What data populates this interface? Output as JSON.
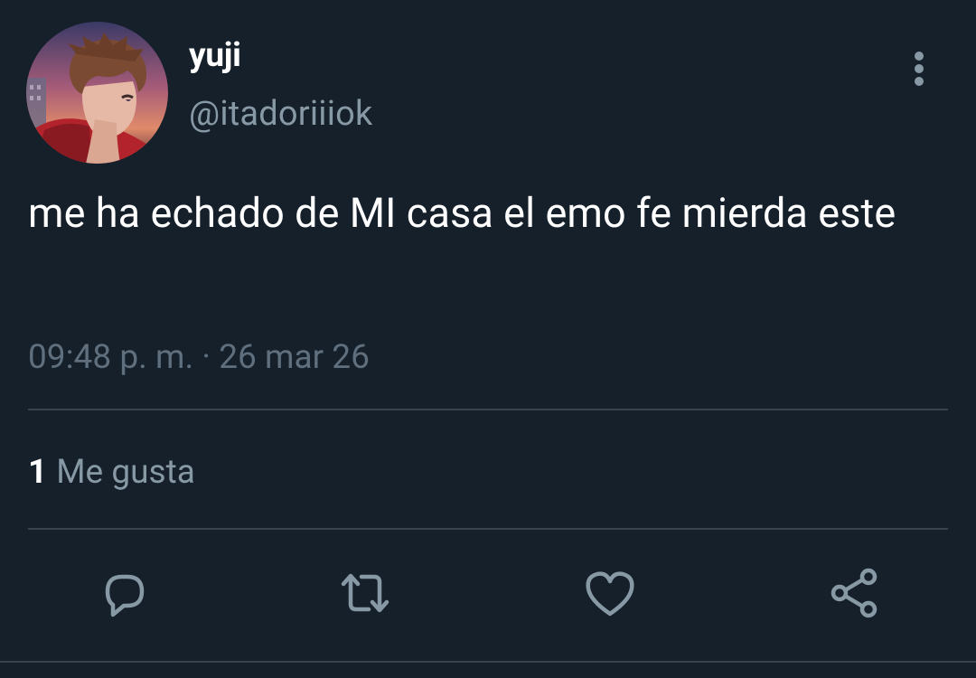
{
  "user": {
    "display_name": "yuji",
    "handle": "@itadoriiiok"
  },
  "tweet": {
    "text": "me ha echado de MI casa el emo fe mierda este",
    "timestamp": "09:48 p. m. · 26 mar 26"
  },
  "stats": {
    "likes_count": "1",
    "likes_label": "Me gusta"
  },
  "actions": {
    "reply_icon": "reply-icon",
    "retweet_icon": "retweet-icon",
    "like_icon": "heart-icon",
    "share_icon": "share-icon"
  },
  "colors": {
    "background": "#15202b",
    "primary_text": "#ffffff",
    "secondary_text": "#8899a6",
    "timestamp_text": "#5f6f7d",
    "divider": "#38444d",
    "icon": "#8899a6"
  }
}
